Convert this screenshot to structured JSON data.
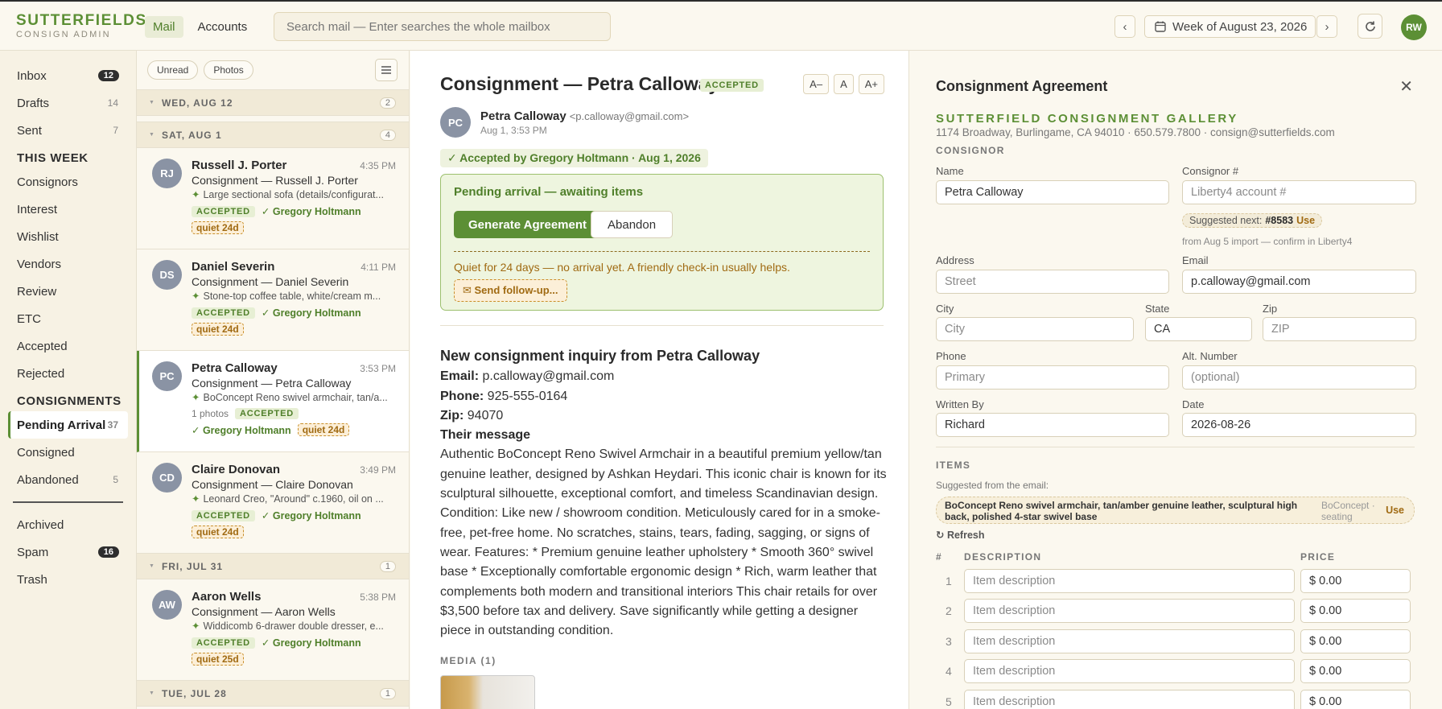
{
  "brand": {
    "name": "SUTTERFIELDS",
    "sub": "CONSIGN ADMIN"
  },
  "topnav": [
    {
      "label": "Mail"
    },
    {
      "label": "Accounts"
    }
  ],
  "search": {
    "placeholder": "Search mail — Enter searches the whole mailbox"
  },
  "week": {
    "prev": "‹",
    "next": "›",
    "label": "Week of August 23, 2026"
  },
  "user": {
    "initials": "RW"
  },
  "sidebar": {
    "mail": [
      {
        "label": "Inbox",
        "count": "12"
      },
      {
        "label": "Drafts",
        "count": "14"
      },
      {
        "label": "Sent",
        "count": "7"
      }
    ],
    "this_week_heading": "THIS WEEK",
    "this_week": [
      {
        "label": "Consignors"
      },
      {
        "label": "Interest"
      },
      {
        "label": "Wishlist"
      },
      {
        "label": "Vendors"
      },
      {
        "label": "Review"
      },
      {
        "label": "ETC"
      },
      {
        "label": "Accepted"
      },
      {
        "label": "Rejected"
      }
    ],
    "consignments_heading": "CONSIGNMENTS",
    "consignments": [
      {
        "label": "Pending Arrival",
        "count": "37"
      },
      {
        "label": "Consigned",
        "count": ""
      },
      {
        "label": "Abandoned",
        "count": "5"
      }
    ],
    "other": [
      {
        "label": "Archived",
        "count": ""
      },
      {
        "label": "Spam",
        "count": "16"
      },
      {
        "label": "Trash",
        "count": ""
      }
    ]
  },
  "list": {
    "filters": [
      "Unread",
      "Photos"
    ],
    "groups": [
      {
        "date": "WED, AUG 12",
        "count": "2"
      },
      {
        "date": "SAT, AUG 1",
        "count": "4"
      },
      {
        "date": "FRI, JUL 31",
        "count": "1"
      },
      {
        "date": "TUE, JUL 28",
        "count": "1"
      }
    ],
    "messages": [
      {
        "initials": "RJ",
        "name": "Russell J. Porter",
        "time": "4:35 PM",
        "subject": "Consignment — Russell J. Porter",
        "snippet": "Large sectional sofa (details/configurat...",
        "status": "ACCEPTED",
        "user": "✓ Gregory Holtmann",
        "quiet": "quiet 24d",
        "photos": ""
      },
      {
        "initials": "DS",
        "name": "Daniel Severin",
        "time": "4:11 PM",
        "subject": "Consignment — Daniel Severin",
        "snippet": "Stone-top coffee table, white/cream m...",
        "status": "ACCEPTED",
        "user": "✓ Gregory Holtmann",
        "quiet": "quiet 24d",
        "photos": ""
      },
      {
        "initials": "PC",
        "name": "Petra Calloway",
        "time": "3:53 PM",
        "subject": "Consignment — Petra Calloway",
        "snippet": "BoConcept Reno swivel armchair, tan/a...",
        "status": "ACCEPTED",
        "user": "✓ Gregory Holtmann",
        "quiet": "quiet 24d",
        "photos": "1 photos"
      },
      {
        "initials": "CD",
        "name": "Claire Donovan",
        "time": "3:49 PM",
        "subject": "Consignment — Claire Donovan",
        "snippet": "Leonard Creo, \"Around\" c.1960, oil on ...",
        "status": "ACCEPTED",
        "user": "✓ Gregory Holtmann",
        "quiet": "quiet 24d",
        "photos": ""
      },
      {
        "initials": "AW",
        "name": "Aaron Wells",
        "time": "5:38 PM",
        "subject": "Consignment — Aaron Wells",
        "snippet": "Widdicomb 6-drawer double dresser, e...",
        "status": "ACCEPTED",
        "user": "✓ Gregory Holtmann",
        "quiet": "quiet 25d",
        "photos": ""
      }
    ]
  },
  "view": {
    "title": "Consignment — Petra Calloway",
    "status": "ACCEPTED",
    "font_buttons": [
      "A–",
      "A",
      "A+"
    ],
    "sender": {
      "initials": "PC",
      "name": "Petra Calloway",
      "email": "<p.calloway@gmail.com>",
      "date": "Aug 1, 3:53 PM"
    },
    "accepted_by": "✓ Accepted by Gregory Holtmann · Aug 1, 2026",
    "pending": {
      "title": "Pending arrival — awaiting items",
      "generate": "Generate Agreement",
      "abandon": "Abandon",
      "quiet": "Quiet for 24 days — no arrival yet. A friendly check-in usually helps.",
      "followup": "✉ Send follow-up..."
    },
    "body": {
      "heading": "New consignment inquiry from Petra Calloway",
      "email_label": "Email:",
      "email": "p.calloway@gmail.com",
      "phone_label": "Phone:",
      "phone": "925-555-0164",
      "zip_label": "Zip:",
      "zip": "94070",
      "message_label": "Their message",
      "message": "Authentic BoConcept Reno Swivel Armchair in a beautiful premium yellow/tan genuine leather, designed by Ashkan Heydari. This iconic chair is known for its sculptural silhouette, exceptional comfort, and timeless Scandinavian design. Condition: Like new / showroom condition. Meticulously cared for in a smoke-free, pet-free home. No scratches, stains, tears, fading, sagging, or signs of wear. Features: * Premium genuine leather upholstery * Smooth 360° swivel base * Exceptionally comfortable ergonomic design * Rich, warm leather that complements both modern and transitional interiors This chair retails for over $3,500 before tax and delivery. Save significantly while getting a designer piece in outstanding condition."
    },
    "media_label": "MEDIA (1)"
  },
  "agreement": {
    "title": "Consignment Agreement",
    "close": "✕",
    "gallery": "SUTTERFIELD CONSIGNMENT GALLERY",
    "address": "1174 Broadway, Burlingame, CA 94010 · 650.579.7800 · consign@sutterfields.com",
    "consignor_label": "CONSIGNOR",
    "fields": {
      "name": {
        "label": "Name",
        "value": "Petra Calloway",
        "placeholder": ""
      },
      "consignor_no": {
        "label": "Consignor #",
        "value": "",
        "placeholder": "Liberty4 account #"
      },
      "address": {
        "label": "Address",
        "value": "",
        "placeholder": "Street"
      },
      "email": {
        "label": "Email",
        "value": "p.calloway@gmail.com",
        "placeholder": ""
      },
      "city": {
        "label": "City",
        "value": "",
        "placeholder": "City"
      },
      "state": {
        "label": "State",
        "value": "CA",
        "placeholder": ""
      },
      "zip": {
        "label": "Zip",
        "value": "",
        "placeholder": "ZIP"
      },
      "phone": {
        "label": "Phone",
        "value": "",
        "placeholder": "Primary"
      },
      "alt": {
        "label": "Alt. Number",
        "value": "",
        "placeholder": "(optional)"
      },
      "written_by": {
        "label": "Written By",
        "value": "Richard",
        "placeholder": ""
      },
      "date": {
        "label": "Date",
        "value": "2026-08-26",
        "placeholder": ""
      }
    },
    "suggested_next": {
      "label": "Suggested next:",
      "value": "#8583",
      "use": "Use",
      "note": "from Aug 5 import — confirm in Liberty4"
    },
    "items_label": "ITEMS",
    "suggested_from": "Suggested from the email:",
    "item_suggestion": {
      "desc": "BoConcept Reno swivel armchair, tan/amber genuine leather, sculptural high back, polished 4-star swivel base",
      "category": "BoConcept · seating",
      "use": "Use"
    },
    "refresh": "↻ Refresh",
    "columns": {
      "num": "#",
      "desc": "DESCRIPTION",
      "price": "PRICE"
    },
    "rows": [
      {
        "num": "1",
        "placeholder": "Item description",
        "price": "$ 0.00"
      },
      {
        "num": "2",
        "placeholder": "Item description",
        "price": "$ 0.00"
      },
      {
        "num": "3",
        "placeholder": "Item description",
        "price": "$ 0.00"
      },
      {
        "num": "4",
        "placeholder": "Item description",
        "price": "$ 0.00"
      },
      {
        "num": "5",
        "placeholder": "Item description",
        "price": "$ 0.00"
      }
    ]
  }
}
